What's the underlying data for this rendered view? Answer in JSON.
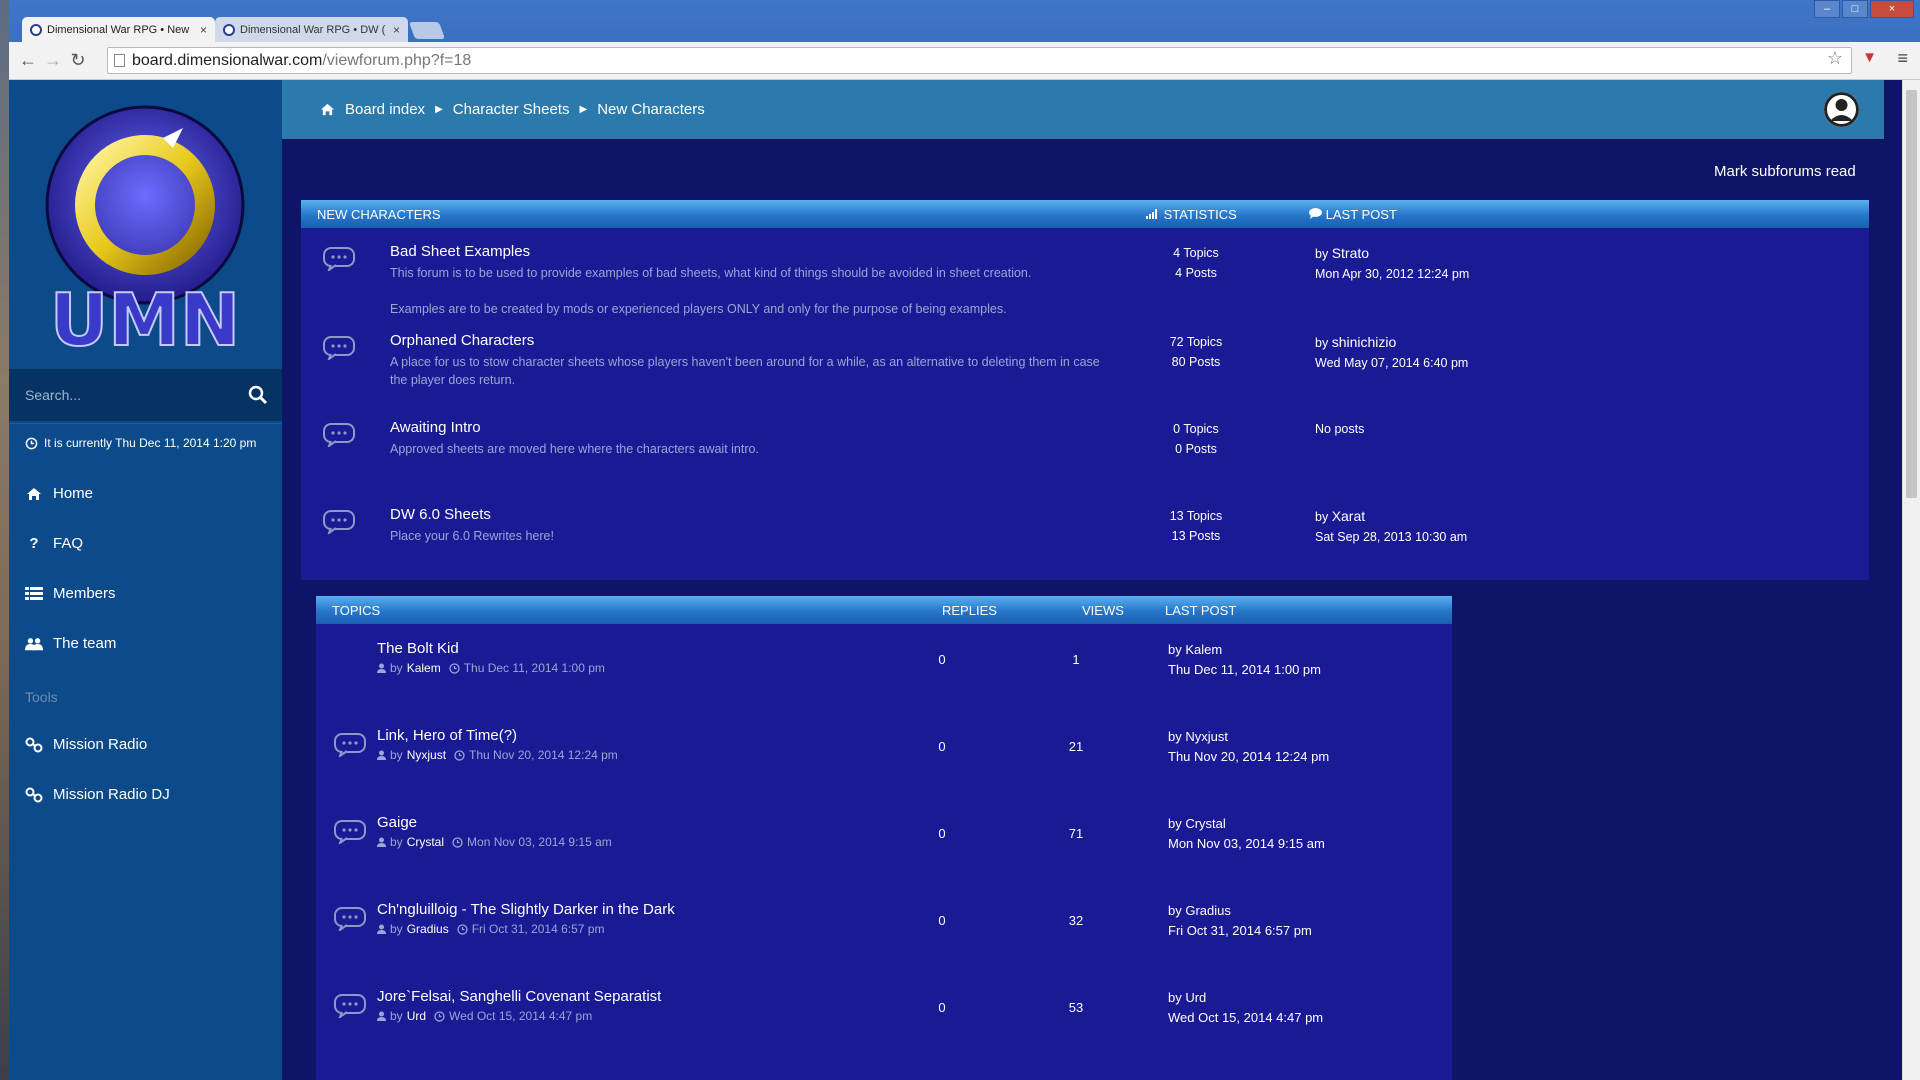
{
  "browser": {
    "tabs": [
      {
        "label": "Dimensional War RPG • New",
        "close": "×"
      },
      {
        "label": "Dimensional War RPG • DW (",
        "close": "×"
      }
    ],
    "window_controls": [
      "–",
      "□",
      "×"
    ],
    "address": {
      "host": "board.dimensionalwar.com",
      "path": "/viewforum.php?f=18"
    }
  },
  "sidebar": {
    "logo_alt": "UMN",
    "search_placeholder": "Search...",
    "current_time": "It is currently Thu Dec 11, 2014 1:20 pm",
    "items": [
      {
        "label": "Home",
        "icon": "home-icon"
      },
      {
        "label": "FAQ",
        "icon": "question-icon"
      },
      {
        "label": "Members",
        "icon": "list-icon"
      },
      {
        "label": "The team",
        "icon": "team-icon"
      }
    ],
    "tools_label": "Tools",
    "tools": [
      {
        "label": "Mission Radio",
        "icon": "link-icon"
      },
      {
        "label": "Mission Radio DJ",
        "icon": "link-icon"
      }
    ]
  },
  "breadcrumbs": [
    "Board index",
    "Character Sheets",
    "New Characters"
  ],
  "mark_read": "Mark subforums read",
  "forum_table": {
    "headers": {
      "forum": "NEW CHARACTERS",
      "stats": "STATISTICS",
      "last": "LAST POST"
    },
    "rows": [
      {
        "title": "Bad Sheet Examples",
        "desc": "This forum is to be used to provide examples of bad sheets, what kind of things should be avoided in sheet creation.",
        "desc2": "Examples are to be created by mods or experienced players ONLY and only for the purpose of being examples.",
        "topics": "4 Topics",
        "posts": "4 Posts",
        "last_by": "by",
        "last_user": "Strato",
        "last_date": "Mon Apr 30, 2012 12:24 pm"
      },
      {
        "title": "Orphaned Characters",
        "desc": "A place for us to stow character sheets whose players haven't been around for a while, as an alternative to deleting them in case the player does return.",
        "desc2": "",
        "topics": "72 Topics",
        "posts": "80 Posts",
        "last_by": "by",
        "last_user": "shinichizio",
        "last_date": "Wed May 07, 2014 6:40 pm"
      },
      {
        "title": "Awaiting Intro",
        "desc": "Approved sheets are moved here where the characters await intro.",
        "desc2": "",
        "topics": "0 Topics",
        "posts": "0 Posts",
        "last_by": "",
        "last_user": "No posts",
        "last_date": ""
      },
      {
        "title": "DW 6.0 Sheets",
        "desc": "Place your 6.0 Rewrites here!",
        "desc2": "",
        "topics": "13 Topics",
        "posts": "13 Posts",
        "last_by": "by",
        "last_user": "Xarat",
        "last_date": "Sat Sep 28, 2013 10:30 am"
      }
    ]
  },
  "topics_table": {
    "headers": {
      "topics": "TOPICS",
      "replies": "REPLIES",
      "views": "VIEWS",
      "last": "LAST POST"
    },
    "rows": [
      {
        "title": "The Bolt Kid",
        "by": "by",
        "user": "Kalem",
        "date": "Thu Dec 11, 2014 1:00 pm",
        "replies": "0",
        "views": "1",
        "last_user": "Kalem",
        "last_date": "Thu Dec 11, 2014 1:00 pm",
        "has_icon": false
      },
      {
        "title": "Link, Hero of Time(?)",
        "by": "by",
        "user": "Nyxjust",
        "date": "Thu Nov 20, 2014 12:24 pm",
        "replies": "0",
        "views": "21",
        "last_user": "Nyxjust",
        "last_date": "Thu Nov 20, 2014 12:24 pm",
        "has_icon": true
      },
      {
        "title": "Gaige",
        "by": "by",
        "user": "Crystal",
        "date": "Mon Nov 03, 2014 9:15 am",
        "replies": "0",
        "views": "71",
        "last_user": "Crystal",
        "last_date": "Mon Nov 03, 2014 9:15 am",
        "has_icon": true
      },
      {
        "title": "Ch'ngluilloig - The Slightly Darker in the Dark",
        "by": "by",
        "user": "Gradius",
        "date": "Fri Oct 31, 2014 6:57 pm",
        "replies": "0",
        "views": "32",
        "last_user": "Gradius",
        "last_date": "Fri Oct 31, 2014 6:57 pm",
        "has_icon": true
      },
      {
        "title": "Jore`Felsai, Sanghelli Covenant Separatist",
        "by": "by",
        "user": "Urd",
        "date": "Wed Oct 15, 2014 4:47 pm",
        "replies": "0",
        "views": "53",
        "last_user": "Urd",
        "last_date": "Wed Oct 15, 2014 4:47 pm",
        "has_icon": true
      }
    ]
  },
  "colors": {
    "page_bg": "#0f1566",
    "sidebar_bg": "#0c4a8a",
    "topbar_bg": "#2c7aab",
    "panel_bg": "#1a1a94"
  }
}
